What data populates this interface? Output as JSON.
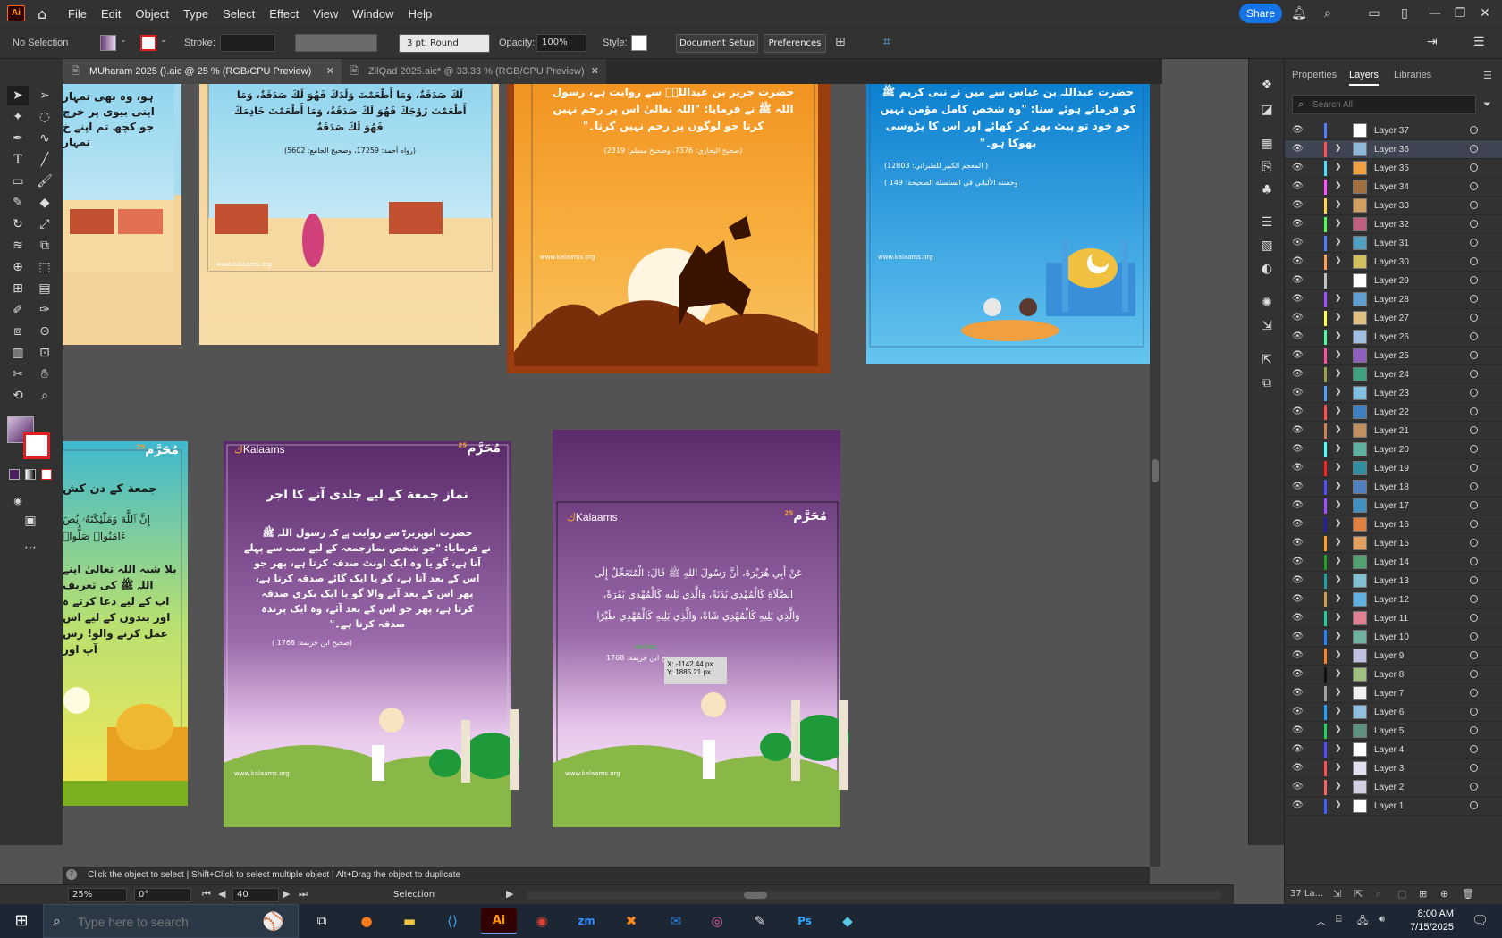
{
  "app": {
    "logo": "Ai",
    "menu": [
      "File",
      "Edit",
      "Object",
      "Type",
      "Select",
      "Effect",
      "View",
      "Window",
      "Help"
    ],
    "share_label": "Share"
  },
  "control_bar": {
    "selection_status": "No Selection",
    "stroke_label": "Stroke:",
    "brush_value": "3 pt. Round",
    "opacity_label": "Opacity:",
    "opacity_value": "100%",
    "style_label": "Style:",
    "document_setup": "Document Setup",
    "preferences": "Preferences"
  },
  "tabs": [
    {
      "label": "MUharam 2025 ().aic @ 25 % (RGB/CPU Preview)",
      "active": true
    },
    {
      "label": "ZilQad 2025.aic* @ 33.33 % (RGB/CPU Preview)",
      "active": false
    }
  ],
  "canvas": {
    "art1_text": [
      "ہو، وہ بھی تمہار",
      "اپنی بیوی پر خرچ",
      "جو کچھ تم اپنے خ",
      "تمہار"
    ],
    "art2_arabic": [
      "لَكَ صَدَقَةٌ، وَمَا أَطْعَمْتَ وَلَدَكَ فَهُوَ لَكَ صَدَقَةٌ، وَمَا",
      "أَطْعَمْتَ زَوْجَكَ فَهُوَ لَكَ صَدَقَةٌ، وَمَا أَطْعَمْتَ خَادِمَكَ",
      "فَهُوَ لَكَ صَدَقَةٌ"
    ],
    "art2_ref": "(رواه أحمد: 17259، وصحيح الجامع: 5602)",
    "art3_text": [
      "حضرت جریر بن عبداللہؓ سے روایت ہے، رسول",
      "اللہ ﷺ نے فرمایا: \"اللہ تعالیٰ اس پر رحم نہیں",
      "کرتا جو لوگوں پر رحم نہیں کرتا۔\""
    ],
    "art3_ref": "(صحیح البخاري: 7376، وصحیح مسلم: 2319)",
    "art4_text": [
      "حضرت عبداللہ بن عباس سے میں نے نبی کریم ﷺ",
      "کو فرماتے ہوئے سنا: \"وہ شخص کامل مؤمن نہیں",
      "جو خود تو پیٹ بھر کر کھائے اور اس کا پڑوسی",
      "بھوکا ہو۔\""
    ],
    "art4_ref1": "( المعجم الكبير للطبراني: 12803)",
    "art4_ref2": "وحسنه الألباني في السلسلة الصحيحة: 149 )",
    "website": "www.kalaams.org",
    "brand": "Kalaams",
    "muharram_badge": "مُحَرَّم",
    "muharram_num": "25",
    "art5_title": "جمعة کے دن کش",
    "art5_arabic": [
      "إِنَّ ٱللَّهَ وَمَلَٰٓئِكَتَهُۥ يُصَ",
      "ءَامَنُوا۟ صَلُّوا۟"
    ],
    "art5_urdu": [
      "بلا شبہ اللہ تعالیٰ اپنے",
      "اللہ ﷺ کی تعریف",
      "اپ کے لیے دعا کرتے ہ",
      "اور بندوں کے لیے اس",
      "عمل کرنے والو! رس",
      "آپ اور"
    ],
    "art6_title": "نماز جمعة کے لیے جلدی آنے کا اجر",
    "art6_text": [
      "حضرت ابوہریرہؓ سے روایت ہے کہ رسول اللہ ﷺ",
      "نے فرمایا: \"جو شخص نمازجمعہ کے لیے سب سے پہلے",
      "آتا ہے، گو یا وہ ایک اونٹ صدقہ کرتا ہے، پھر جو",
      "اس کے بعد آتا ہے، گو یا ایک گائے صدقہ کرتا ہے،",
      "پھر اس کے بعد آنے والا گو یا ایک بکری صدقہ",
      "کرتا ہے، پھر جو اس کے بعد آئے، وہ ایک پرندہ",
      "صدقہ کرتا ہے۔\""
    ],
    "art6_ref": "(صحیح ابن خزیمة: 1768 )",
    "art7_arabic": [
      "عَنْ أَبِي هُرَيْرَةَ، أَنَّ رَسُولَ اللهِ ﷺ قَالَ: الْمُتَعَجِّلُ إِلَى",
      "الصَّلَاةِ كَالْمُهْدِي بَدَنَةً، وَالَّذِي يَلِيهِ كَالْمُهْدِي بَقَرَةً،",
      "وَالَّذِي يَلِيهِ كَالْمُهْدِي شَاةً، وَالَّذِي يَلِيهِ كَالْمُهْدِي طَيْرًا"
    ],
    "art7_ref": "صحیح ابن خزیمة: 1768",
    "tooltip_anchor": "anchor",
    "tooltip_x": "X: -1142.44 px",
    "tooltip_y": "Y: 1885.21 px"
  },
  "panel": {
    "tabs": [
      "Properties",
      "Layers",
      "Libraries"
    ],
    "search_placeholder": "Search All",
    "layer_count": "37 La...",
    "layers": [
      {
        "name": "Layer 37",
        "color": "#4f7fff",
        "thumb": "#ffffff",
        "expandable": false
      },
      {
        "name": "Layer 36",
        "color": "#ff4f4f",
        "thumb": "#8fb8d8",
        "expandable": true,
        "selected": true
      },
      {
        "name": "Layer 35",
        "color": "#4fe0ff",
        "thumb": "#f0a040",
        "expandable": true
      },
      {
        "name": "Layer 34",
        "color": "#ff4fff",
        "thumb": "#a07040",
        "expandable": true
      },
      {
        "name": "Layer 33",
        "color": "#ffd24f",
        "thumb": "#d0a060",
        "expandable": true
      },
      {
        "name": "Layer 32",
        "color": "#4fff4f",
        "thumb": "#c06080",
        "expandable": true
      },
      {
        "name": "Layer 31",
        "color": "#4f7fff",
        "thumb": "#50a0c0",
        "expandable": true
      },
      {
        "name": "Layer 30",
        "color": "#ff9f4f",
        "thumb": "#d0c060",
        "expandable": true
      },
      {
        "name": "Layer 29",
        "color": "#c0c0c0",
        "thumb": "#ffffff",
        "expandable": false
      },
      {
        "name": "Layer 28",
        "color": "#9f4fff",
        "thumb": "#60a0d0",
        "expandable": true
      },
      {
        "name": "Layer 27",
        "color": "#ffff4f",
        "thumb": "#e0c080",
        "expandable": true
      },
      {
        "name": "Layer 26",
        "color": "#4fff9f",
        "thumb": "#a0c0e0",
        "expandable": true
      },
      {
        "name": "Layer 25",
        "color": "#ff4fa0",
        "thumb": "#9060c0",
        "expandable": true
      },
      {
        "name": "Layer 24",
        "color": "#a0a04f",
        "thumb": "#40a080",
        "expandable": true
      },
      {
        "name": "Layer 23",
        "color": "#4fa0ff",
        "thumb": "#80c0e0",
        "expandable": true
      },
      {
        "name": "Layer 22",
        "color": "#ff4f4f",
        "thumb": "#4080c0",
        "expandable": true
      },
      {
        "name": "Layer 21",
        "color": "#d0804f",
        "thumb": "#c09060",
        "expandable": true
      },
      {
        "name": "Layer 20",
        "color": "#4fffff",
        "thumb": "#60b0a0",
        "expandable": true
      },
      {
        "name": "Layer 19",
        "color": "#ff2020",
        "thumb": "#3090a0",
        "expandable": true
      },
      {
        "name": "Layer 18",
        "color": "#4f4fff",
        "thumb": "#5080c0",
        "expandable": true
      },
      {
        "name": "Layer 17",
        "color": "#a04fff",
        "thumb": "#4090c0",
        "expandable": true
      },
      {
        "name": "Layer 16",
        "color": "#2020a0",
        "thumb": "#e08040",
        "expandable": true
      },
      {
        "name": "Layer 15",
        "color": "#ff9f20",
        "thumb": "#e0a060",
        "expandable": true
      },
      {
        "name": "Layer 14",
        "color": "#20a020",
        "thumb": "#50a070",
        "expandable": true
      },
      {
        "name": "Layer 13",
        "color": "#20a0a0",
        "thumb": "#80c0d0",
        "expandable": true
      },
      {
        "name": "Layer 12",
        "color": "#d0a04f",
        "thumb": "#60b0e0",
        "expandable": true
      },
      {
        "name": "Layer 11",
        "color": "#20d0a0",
        "thumb": "#e08090",
        "expandable": true
      },
      {
        "name": "Layer 10",
        "color": "#2080ff",
        "thumb": "#70b0a0",
        "expandable": true
      },
      {
        "name": "Layer 9",
        "color": "#ff8020",
        "thumb": "#c0c0e0",
        "expandable": true
      },
      {
        "name": "Layer 8",
        "color": "#101010",
        "thumb": "#a0c080",
        "expandable": true
      },
      {
        "name": "Layer 7",
        "color": "#a0a0a0",
        "thumb": "#f0f0f0",
        "expandable": true
      },
      {
        "name": "Layer 6",
        "color": "#20a0ff",
        "thumb": "#90c0e0",
        "expandable": true
      },
      {
        "name": "Layer 5",
        "color": "#20d060",
        "thumb": "#609080",
        "expandable": true
      },
      {
        "name": "Layer 4",
        "color": "#4f4fff",
        "thumb": "#ffffff",
        "expandable": true
      },
      {
        "name": "Layer 3",
        "color": "#ff4f4f",
        "thumb": "#e0e0f0",
        "expandable": true
      },
      {
        "name": "Layer 2",
        "color": "#ff6060",
        "thumb": "#d0d0e0",
        "expandable": true
      },
      {
        "name": "Layer 1",
        "color": "#4060ff",
        "thumb": "#ffffff",
        "expandable": true
      }
    ]
  },
  "status": {
    "hint": "Click the object to select  |  Shift+Click to select multiple object  |  Alt+Drag the object to duplicate",
    "zoom": "25%",
    "rotate": "0°",
    "artboard": "40",
    "tool": "Selection"
  },
  "taskbar": {
    "search_placeholder": "Type here to search",
    "time": "8:00 AM",
    "date": "7/15/2025"
  },
  "colors": {
    "accent": "#1473e6",
    "ui_dark": "#323232",
    "canvas": "#535353"
  }
}
